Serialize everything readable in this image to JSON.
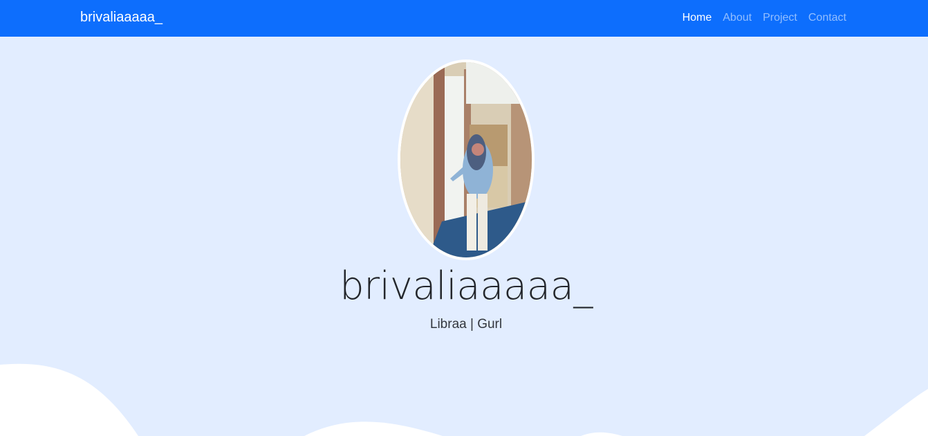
{
  "navbar": {
    "brand": "brivaliaaaaa_",
    "links": [
      {
        "label": "Home",
        "active": true
      },
      {
        "label": "About",
        "active": false
      },
      {
        "label": "Project",
        "active": false
      },
      {
        "label": "Contact",
        "active": false
      }
    ]
  },
  "hero": {
    "title": "brivaliaaaaa_",
    "subtitle": "Libraa | Gurl",
    "photo_alt": "profile-photo"
  },
  "colors": {
    "navbar_bg": "#0d6efd",
    "hero_bg": "#e2edff",
    "wave": "#ffffff"
  }
}
